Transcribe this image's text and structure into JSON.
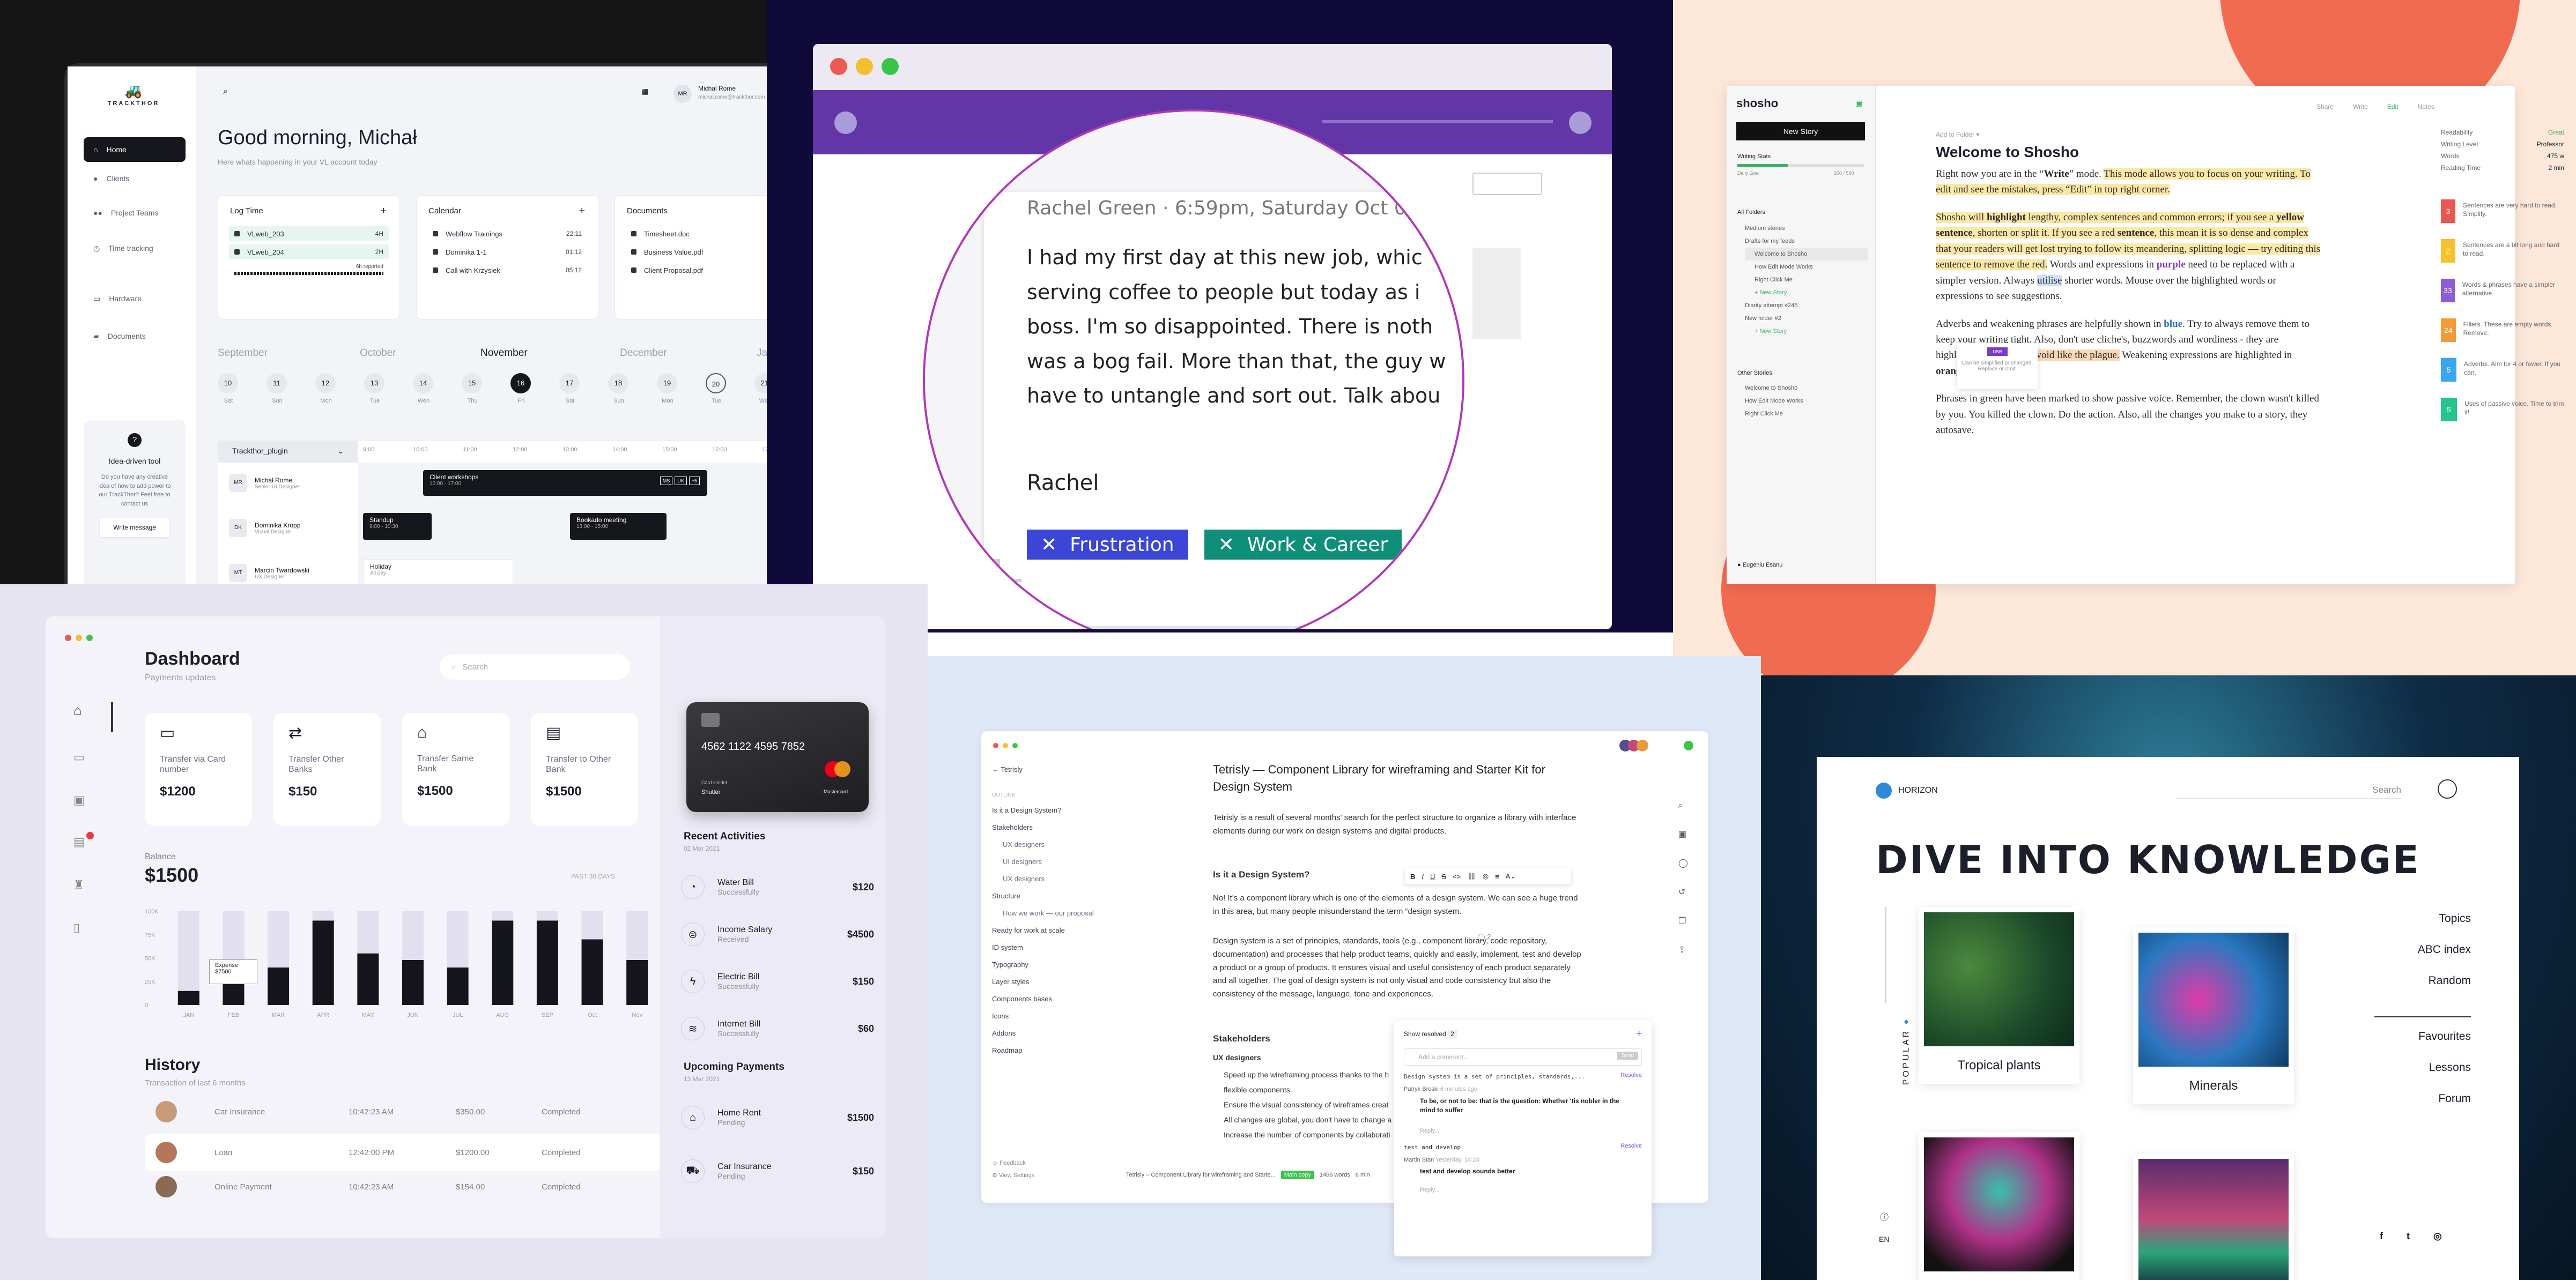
{
  "trackthor": {
    "logo": "TRACKTHOR",
    "nav": [
      "Home",
      "Clients",
      "Project Teams",
      "Time tracking",
      "Hardware",
      "Documents"
    ],
    "help": {
      "title": "Idea-driven tool",
      "text": "Do you have any creative idea of how to add power to our TrackThor? Feel free to contact us",
      "button": "Write message"
    },
    "user": {
      "initials": "MR",
      "name": "Michal Rome",
      "email": "michal.rome@trackthor.com"
    },
    "greeting": "Good morning, Michał",
    "subtitle": "Here whats happening in your VL account today",
    "logtime": {
      "title": "Log Time",
      "add": "+",
      "rows": [
        {
          "name": "VLweb_203",
          "val": "4H"
        },
        {
          "name": "VLweb_204",
          "val": "2H"
        }
      ],
      "reported": "6h reported"
    },
    "calendar": {
      "title": "Calendar",
      "add": "+",
      "rows": [
        {
          "name": "Webflow Trainings",
          "val": "22:11"
        },
        {
          "name": "Dominika 1-1",
          "val": "01:12"
        },
        {
          "name": "Call with Krzysiek",
          "val": "05:12"
        }
      ]
    },
    "documents": {
      "title": "Documents",
      "rows": [
        "Timesheet.doc",
        "Business Value.pdf",
        "Client Proposal.pdf"
      ]
    },
    "months": [
      "September",
      "October",
      "November",
      "December",
      "Ja"
    ],
    "days": [
      {
        "d": "10",
        "w": "Sat"
      },
      {
        "d": "11",
        "w": "Sun"
      },
      {
        "d": "12",
        "w": "Mon"
      },
      {
        "d": "13",
        "w": "Tue"
      },
      {
        "d": "14",
        "w": "Wen"
      },
      {
        "d": "15",
        "w": "Thu"
      },
      {
        "d": "16",
        "w": "Fri"
      },
      {
        "d": "17",
        "w": "Sat"
      },
      {
        "d": "18",
        "w": "Sun"
      },
      {
        "d": "19",
        "w": "Mon"
      },
      {
        "d": "20",
        "w": "Tue"
      },
      {
        "d": "21",
        "w": "Wen"
      }
    ],
    "plugin": "Trackthor_plugin",
    "times": [
      "9:00",
      "10:00",
      "11:00",
      "12:00",
      "13:00",
      "14:00",
      "15:00",
      "16:00",
      "17:00"
    ],
    "people": [
      {
        "ini": "MR",
        "name": "Michał Rome",
        "role": "Senior UI Designer"
      },
      {
        "ini": "DK",
        "name": "Dominika Kropp",
        "role": "Visual Designer"
      },
      {
        "ini": "MT",
        "name": "Marcin Twardowski",
        "role": "UX Designer"
      }
    ],
    "events": [
      {
        "t": "Client workshops",
        "s": "10:00 - 17:00"
      },
      {
        "t": "Standup",
        "s": "9:00 - 10:30"
      },
      {
        "t": "Bookado meeting",
        "s": "13:00 - 15:00"
      },
      {
        "t": "Holiday",
        "s": "All day"
      }
    ],
    "event_avatars": [
      "MS",
      "UK",
      "+5"
    ]
  },
  "rachel": {
    "header": "Rachel Green · 6:59pm, Saturday Oct 0",
    "lines": [
      "I had my first day at this new job, whic",
      "serving coffee to people but today as i",
      "boss. I'm so disappointed. There is noth",
      "was a bog fail. More than that, the guy w",
      "have to untangle and sort out. Talk abou"
    ],
    "signature": "Rachel",
    "tags": [
      {
        "x": "✕",
        "label": "Frustration",
        "color": "#3b45d6"
      },
      {
        "x": "✕",
        "label": "Work & Career",
        "color": "#0f8f7a"
      }
    ]
  },
  "shosho": {
    "logo": "shosho",
    "new_story": "New Story",
    "writing_stats": "Writing Stats",
    "goal": "Daily Goal",
    "goal_val": "200 / 500",
    "folders_title": "All Folders",
    "folders": [
      "Medium stories",
      "Drafts for my feeds",
      "Welcome to Shosho",
      "How Edit Mode Works",
      "Right Click Me",
      "+ New Story",
      "Diarity attempt #245",
      "New folder #2",
      "+ New Story"
    ],
    "other_title": "Other Stories",
    "other": [
      "Welcome to Shosho",
      "How Edit Mode Works",
      "Right Click Me"
    ],
    "user": "Eugeniu Esanu",
    "toolbar": [
      "Share",
      "Write",
      "Edit",
      "Notes"
    ],
    "crumb": "Add to Folder ▾",
    "title": "Welcome to Shosho",
    "stats": [
      {
        "k": "Readability",
        "v": "Great"
      },
      {
        "k": "Writing Level",
        "v": "Professor"
      },
      {
        "k": "Words",
        "v": "475 w"
      },
      {
        "k": "Reading Time",
        "v": "2 min"
      }
    ],
    "p1a": "Right now you are in the “",
    "p1b": "Write",
    "p1c": "” mode. ",
    "p1d": "This mode allows you to focus on your writing. To edit and see the mistakes, press “Edit” in top right corner.",
    "tooltip_word": "use",
    "tooltip_text": "Can be simplified or changed. Replace or omit.",
    "p3": "Phrases in green have been marked to show passive voice. Remember, the clown wasn't killed by you. You killed the clown. Do the action. Also, all the changes you make to a story, they autosave.",
    "suggestions": [
      {
        "n": "3",
        "c": "#e8584f",
        "t": "Sentences are very hard to read. Simplify."
      },
      {
        "n": "2",
        "c": "#f4c130",
        "t": "Sentences are a bit long and hard to read."
      },
      {
        "n": "33",
        "c": "#8d5bd6",
        "t": "Words & phrases have a simpler alternative."
      },
      {
        "n": "24",
        "c": "#f39a3a",
        "t": "Fillers. These are empty words. Remove."
      },
      {
        "n": "5",
        "c": "#39a6f0",
        "t": "Adverbs. Aim for 4 or fewer. If you can."
      },
      {
        "n": "5",
        "c": "#27c48c",
        "t": "Uses of passive voice. Time to trim it!"
      }
    ]
  },
  "dashboard": {
    "title": "Dashboard",
    "subtitle": "Payments updates",
    "search_placeholder": "Search",
    "transfers": [
      {
        "label": "Transfer via Card number",
        "val": "$1200"
      },
      {
        "label": "Transfer Other Banks",
        "val": "$150"
      },
      {
        "label": "Transfer Same Bank",
        "val": "$1500"
      },
      {
        "label": "Transfer to Other Bank",
        "val": "$1500"
      }
    ],
    "balance_label": "Balance",
    "balance": "$1500",
    "period": "PAST 30 DAYS",
    "tooltip": {
      "t": "Expense",
      "v": "$7500"
    },
    "history_title": "History",
    "history_sub": "Transaction of last 6 months",
    "history": [
      {
        "name": "Car Insurance",
        "time": "10:42:23 AM",
        "amt": "$350.00",
        "st": "Completed"
      },
      {
        "name": "Loan",
        "time": "12:42:00 PM",
        "amt": "$1200.00",
        "st": "Completed"
      },
      {
        "name": "Online Payment",
        "time": "10:42:23 AM",
        "amt": "$154.00",
        "st": "Completed"
      }
    ],
    "card": {
      "number": "4562 1122 4595 7852",
      "holder_l": "Card Holder",
      "holder": "Shutter",
      "brand": "Mastercard"
    },
    "recent_title": "Recent Activities",
    "recent_date": "02 Mar 2021",
    "recent": [
      {
        "icon": "◔",
        "t": "Water Bill",
        "s": "Successfully",
        "a": "$120"
      },
      {
        "icon": "⊜",
        "t": "Income Salary",
        "s": "Received",
        "a": "$4500"
      },
      {
        "icon": "ϟ",
        "t": "Electric Bill",
        "s": "Successfully",
        "a": "$150"
      },
      {
        "icon": "≋",
        "t": "Internet Bill",
        "s": "Successfully",
        "a": "$60"
      }
    ],
    "upcoming_title": "Upcoming Payments",
    "upcoming_date": "13 Mar 2021",
    "upcoming": [
      {
        "icon": "⌂",
        "t": "Home Rent",
        "s": "Pending",
        "a": "$1500"
      },
      {
        "icon": "⛟",
        "t": "Car Insurance",
        "s": "Pending",
        "a": "$150"
      }
    ]
  },
  "chart_data": {
    "type": "bar",
    "categories": [
      "JAN",
      "FEB",
      "MAR",
      "APR",
      "MAY",
      "JUN",
      "JUL",
      "AUG",
      "SEP",
      "Oct",
      "Nov"
    ],
    "series": [
      {
        "values": [
          15,
          30,
          40,
          90,
          55,
          48,
          40,
          90,
          90,
          70,
          48
        ]
      }
    ],
    "ylim": [
      0,
      100
    ],
    "yticks": [
      "100K",
      "75K",
      "50K",
      "25K",
      "0"
    ]
  },
  "tetrisly": {
    "back": "Tetrisly",
    "outline": "OUTLINE",
    "nav": [
      {
        "t": "Is it a Design System?",
        "s": false
      },
      {
        "t": "Stakeholders",
        "s": false
      },
      {
        "t": "UX designers",
        "s": true
      },
      {
        "t": "UI designers",
        "s": true
      },
      {
        "t": "UX designers",
        "s": true
      },
      {
        "t": "Structure",
        "s": false
      },
      {
        "t": "How we work — our proposal",
        "s": true
      },
      {
        "t": "Ready for work at scale",
        "s": false
      },
      {
        "t": "ID system",
        "s": false
      },
      {
        "t": "Typography",
        "s": false
      },
      {
        "t": "Layer styles",
        "s": false
      },
      {
        "t": "Components bases",
        "s": false
      },
      {
        "t": "Icons",
        "s": false
      },
      {
        "t": "Addons",
        "s": false
      },
      {
        "t": "Roadmap",
        "s": false
      }
    ],
    "footer": [
      "Feedback",
      "View Settings"
    ],
    "title": "Tetrisly — Component Library for wireframing and Starter Kit for Design System",
    "intro": "Tetrisly is a result of several months' search for the perfect structure to organize a library with interface elements during our work on design systems and digital products.",
    "h_is": "Is it a Design System?",
    "p_is": "No! It's a component library which is one of the elements of a design system. We can see a huge trend in this area, but many people misunderstand the term “design system.",
    "p_ds": "Design system is a set of principles, standards, tools (e.g., component library, code repository, documentation) and processes that help product teams, quickly and easily, implement, test and develop a product or a group of products. It ensures visual and useful consistency of each product separately and all together. The goal of design system is not only visual and code consistency but also the consistency of the message, language, tone and experiences.",
    "h_st": "Stakeholders",
    "h_ux": "UX designers",
    "bullets": [
      "Speed up the wireframing process thanks to the h",
      "flexible components.",
      "Ensure the visual consistency of wireframes creat",
      "All changes are global, you don't have to change a",
      "Increase the number of components by collaborati"
    ],
    "status": {
      "doc": "Tetrisly – Component Library for wireframing and Starte...",
      "badge": "Main copy",
      "words": "1466 words",
      "time": "6 min"
    },
    "comments": {
      "show": "Show resolved",
      "count": "2",
      "placeholder": "Add a comment...",
      "send": "Send",
      "quote1": "Design system is a set of principles, standards,...",
      "resolve": "Resolve",
      "a1": "Patryk Broski",
      "a1t": "6 minutes ago",
      "c1": "To be, or not to be: that is the question: Whether 'tis nobler in the mind to suffer",
      "reply": "Reply...",
      "quote2": "test and develop",
      "a2": "Martin Stan",
      "a2t": "Yesterday, 14:23",
      "c2": "test and develop sounds better"
    }
  },
  "horizon": {
    "brand": "HORIZON",
    "search": "Search",
    "headline": "DIVE INTO KNOWLEDGE",
    "side_label": "POPULAR",
    "lang": "EN",
    "items": [
      {
        "label": "Tropical plants"
      },
      {
        "label": "Minerals"
      }
    ],
    "menu1": [
      "Topics",
      "ABC index",
      "Random"
    ],
    "menu2": [
      "Favourites",
      "Lessons",
      "Forum"
    ],
    "social": [
      "f",
      "t",
      "◎"
    ]
  }
}
